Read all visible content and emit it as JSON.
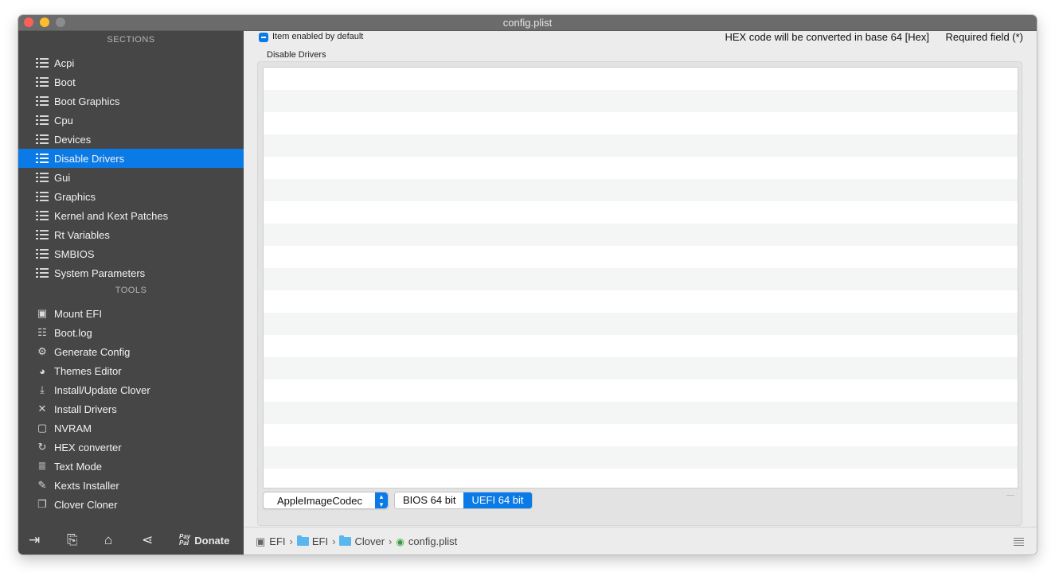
{
  "window": {
    "title": "config.plist"
  },
  "sidebar": {
    "sections_header": "SECTIONS",
    "sections": [
      {
        "label": "Acpi",
        "active": false
      },
      {
        "label": "Boot",
        "active": false
      },
      {
        "label": "Boot Graphics",
        "active": false
      },
      {
        "label": "Cpu",
        "active": false
      },
      {
        "label": "Devices",
        "active": false
      },
      {
        "label": "Disable Drivers",
        "active": true
      },
      {
        "label": "Gui",
        "active": false
      },
      {
        "label": "Graphics",
        "active": false
      },
      {
        "label": "Kernel and Kext Patches",
        "active": false
      },
      {
        "label": "Rt Variables",
        "active": false
      },
      {
        "label": "SMBIOS",
        "active": false
      },
      {
        "label": "System Parameters",
        "active": false
      }
    ],
    "tools_header": "TOOLS",
    "tools": [
      {
        "label": "Mount EFI",
        "icon": "disk-icon"
      },
      {
        "label": "Boot.log",
        "icon": "log-search-icon"
      },
      {
        "label": "Generate Config",
        "icon": "gears-icon"
      },
      {
        "label": "Themes Editor",
        "icon": "palette-icon"
      },
      {
        "label": "Install/Update Clover",
        "icon": "download-icon"
      },
      {
        "label": "Install Drivers",
        "icon": "tools-icon"
      },
      {
        "label": "NVRAM",
        "icon": "chip-icon"
      },
      {
        "label": "HEX converter",
        "icon": "refresh-icon"
      },
      {
        "label": "Text Mode",
        "icon": "text-lines-icon"
      },
      {
        "label": "Kexts Installer",
        "icon": "brush-icon"
      },
      {
        "label": "Clover Cloner",
        "icon": "copy-icon"
      }
    ],
    "bottom": {
      "donate_label": "Donate",
      "paypal_line1": "Pay",
      "paypal_line2": "Pal"
    }
  },
  "main": {
    "checkbox_label": "Item enabled by default",
    "hex_note": "HEX code will be converted in base 64 [Hex]",
    "required_note": "Required field (*)",
    "group_label": "Disable Drivers",
    "driver_popup_value": "AppleImageCodec",
    "segments": [
      "BIOS 64 bit",
      "UEFI 64 bit"
    ],
    "selected_segment": "UEFI 64 bit"
  },
  "pathbar": {
    "crumbs": [
      "EFI",
      "EFI",
      "Clover",
      "config.plist"
    ],
    "separator": "›"
  },
  "colors": {
    "accent": "#0a7ae6",
    "sidebar_bg": "#464646"
  }
}
